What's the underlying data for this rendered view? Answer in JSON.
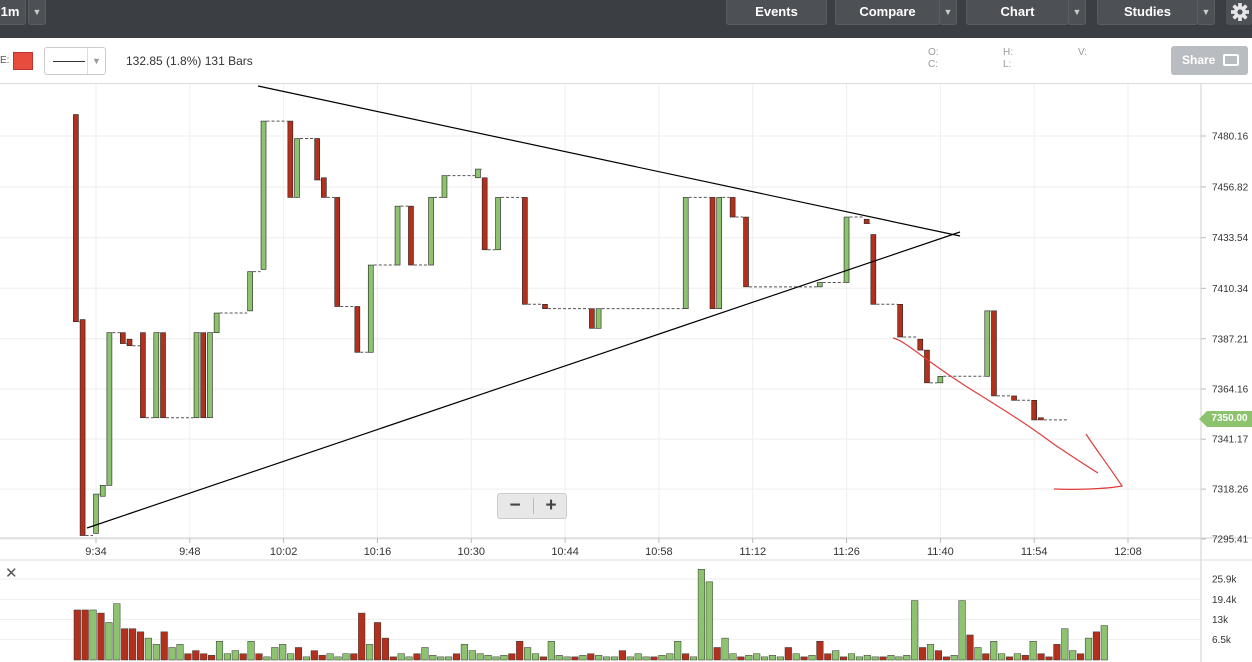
{
  "toolbar": {
    "interval": "1m",
    "events": "Events",
    "compare": "Compare",
    "chart": "Chart",
    "studies": "Studies",
    "caret": "▼",
    "settings_icon": "gear-icon"
  },
  "subbar": {
    "color_label": "E:",
    "series_color": "#e74c3c",
    "summary": "132.85 (1.8%) 131 Bars",
    "o_label": "O:",
    "c_label": "C:",
    "h_label": "H:",
    "l_label": "L:",
    "v_label": "V:",
    "share": "Share"
  },
  "zoom": {
    "out": "−",
    "in": "+"
  },
  "volume_panel": {
    "close": "✕"
  },
  "chart_data": {
    "type": "bar",
    "style": "hlc-bars",
    "up_color": "#8dc26f",
    "down_color": "#b3311c",
    "y_ticks": [
      "7480.16",
      "7456.82",
      "7433.54",
      "7410.34",
      "7387.21",
      "7364.16",
      "7341.17",
      "7318.26",
      "7295.41"
    ],
    "x_ticks": [
      "9:34",
      "9:48",
      "10:02",
      "10:16",
      "10:30",
      "10:44",
      "10:58",
      "11:12",
      "11:26",
      "11:40",
      "11:54",
      "12:08"
    ],
    "last_price": "7350.00",
    "ylim": [
      7295.41,
      7490
    ],
    "grid": true,
    "bars": [
      {
        "t": "9:31",
        "high": 7490,
        "low": 7395,
        "dir": "down"
      },
      {
        "t": "9:32",
        "high": 7396,
        "low": 7297,
        "dir": "down"
      },
      {
        "t": "9:34",
        "high": 7316,
        "low": 7298,
        "dir": "up"
      },
      {
        "t": "9:35",
        "high": 7320,
        "low": 7315,
        "dir": "up"
      },
      {
        "t": "9:36",
        "high": 7390,
        "low": 7320,
        "dir": "up"
      },
      {
        "t": "9:38",
        "high": 7390,
        "low": 7385,
        "dir": "down"
      },
      {
        "t": "9:39",
        "high": 7387,
        "low": 7384,
        "dir": "down"
      },
      {
        "t": "9:41",
        "high": 7390,
        "low": 7351,
        "dir": "down"
      },
      {
        "t": "9:43",
        "high": 7390,
        "low": 7351,
        "dir": "up"
      },
      {
        "t": "9:44",
        "high": 7390,
        "low": 7351,
        "dir": "down"
      },
      {
        "t": "9:49",
        "high": 7390,
        "low": 7351,
        "dir": "up"
      },
      {
        "t": "9:50",
        "high": 7390,
        "low": 7351,
        "dir": "down"
      },
      {
        "t": "9:51",
        "high": 7390,
        "low": 7351,
        "dir": "up"
      },
      {
        "t": "9:52",
        "high": 7399,
        "low": 7390,
        "dir": "up"
      },
      {
        "t": "9:57",
        "high": 7418,
        "low": 7400,
        "dir": "up"
      },
      {
        "t": "9:59",
        "high": 7487,
        "low": 7419,
        "dir": "up"
      },
      {
        "t": "10:03",
        "high": 7487,
        "low": 7452,
        "dir": "down"
      },
      {
        "t": "10:04",
        "high": 7479,
        "low": 7452,
        "dir": "up"
      },
      {
        "t": "10:07",
        "high": 7479,
        "low": 7460,
        "dir": "down"
      },
      {
        "t": "10:08",
        "high": 7461,
        "low": 7452,
        "dir": "down"
      },
      {
        "t": "10:10",
        "high": 7452,
        "low": 7402,
        "dir": "down"
      },
      {
        "t": "10:13",
        "high": 7402,
        "low": 7381,
        "dir": "down"
      },
      {
        "t": "10:15",
        "high": 7421,
        "low": 7381,
        "dir": "up"
      },
      {
        "t": "10:19",
        "high": 7448,
        "low": 7421,
        "dir": "up"
      },
      {
        "t": "10:21",
        "high": 7448,
        "low": 7421,
        "dir": "down"
      },
      {
        "t": "10:24",
        "high": 7452,
        "low": 7421,
        "dir": "up"
      },
      {
        "t": "10:26",
        "high": 7462,
        "low": 7452,
        "dir": "up"
      },
      {
        "t": "10:31",
        "high": 7465,
        "low": 7461,
        "dir": "up"
      },
      {
        "t": "10:32",
        "high": 7461,
        "low": 7428,
        "dir": "down"
      },
      {
        "t": "10:34",
        "high": 7452,
        "low": 7428,
        "dir": "up"
      },
      {
        "t": "10:38",
        "high": 7452,
        "low": 7403,
        "dir": "down"
      },
      {
        "t": "10:41",
        "high": 7403,
        "low": 7401,
        "dir": "down"
      },
      {
        "t": "10:48",
        "high": 7401,
        "low": 7392,
        "dir": "down"
      },
      {
        "t": "10:49",
        "high": 7401,
        "low": 7392,
        "dir": "up"
      },
      {
        "t": "11:02",
        "high": 7452,
        "low": 7401,
        "dir": "up"
      },
      {
        "t": "11:06",
        "high": 7452,
        "low": 7401,
        "dir": "down"
      },
      {
        "t": "11:07",
        "high": 7452,
        "low": 7401,
        "dir": "up"
      },
      {
        "t": "11:09",
        "high": 7452,
        "low": 7443,
        "dir": "down"
      },
      {
        "t": "11:11",
        "high": 7443,
        "low": 7411,
        "dir": "down"
      },
      {
        "t": "11:22",
        "high": 7413,
        "low": 7411,
        "dir": "up"
      },
      {
        "t": "11:26",
        "high": 7443,
        "low": 7413,
        "dir": "up"
      },
      {
        "t": "11:29",
        "high": 7442,
        "low": 7440,
        "dir": "down"
      },
      {
        "t": "11:30",
        "high": 7435,
        "low": 7403,
        "dir": "down"
      },
      {
        "t": "11:34",
        "high": 7403,
        "low": 7388,
        "dir": "down"
      },
      {
        "t": "11:37",
        "high": 7387,
        "low": 7382,
        "dir": "down"
      },
      {
        "t": "11:38",
        "high": 7382,
        "low": 7367,
        "dir": "down"
      },
      {
        "t": "11:40",
        "high": 7370,
        "low": 7367,
        "dir": "up"
      },
      {
        "t": "11:47",
        "high": 7400,
        "low": 7370,
        "dir": "up"
      },
      {
        "t": "11:48",
        "high": 7400,
        "low": 7361,
        "dir": "down"
      },
      {
        "t": "11:51",
        "high": 7361,
        "low": 7359,
        "dir": "down"
      },
      {
        "t": "11:54",
        "high": 7359,
        "low": 7350,
        "dir": "down"
      },
      {
        "t": "11:55",
        "high": 7351,
        "low": 7350,
        "dir": "down"
      }
    ],
    "volume_ticks": [
      "25.9k",
      "19.4k",
      "13k",
      "6.5k"
    ],
    "volume_max": 29000,
    "volume_colors": [
      "r",
      "r",
      "g",
      "r",
      "g",
      "g",
      "r",
      "r",
      "r",
      "g",
      "g",
      "r",
      "g",
      "g",
      "r",
      "r",
      "r",
      "r",
      "g",
      "g",
      "g",
      "r",
      "g",
      "r",
      "g",
      "g",
      "g",
      "g",
      "r",
      "g",
      "r",
      "r",
      "g",
      "g",
      "g",
      "r",
      "r",
      "g",
      "r",
      "r",
      "r",
      "g",
      "g",
      "r",
      "g",
      "g",
      "g",
      "g",
      "r",
      "g",
      "g",
      "g",
      "g",
      "g",
      "g",
      "r",
      "r",
      "g",
      "g",
      "r",
      "g",
      "g",
      "g",
      "r",
      "g",
      "r",
      "g",
      "g",
      "g",
      "r",
      "g",
      "g",
      "g",
      "r",
      "g",
      "g",
      "g",
      "r",
      "g",
      "g",
      "g",
      "r",
      "g",
      "g",
      "r",
      "g",
      "g",
      "g",
      "g",
      "g",
      "r",
      "g",
      "r",
      "g",
      "r",
      "r",
      "g",
      "r",
      "g",
      "g",
      "g",
      "g",
      "r",
      "g",
      "g",
      "g",
      "g",
      "r",
      "g",
      "r",
      "r",
      "g",
      "g",
      "r",
      "g",
      "r",
      "g",
      "g",
      "r",
      "g",
      "r",
      "g",
      "r",
      "r",
      "r",
      "g",
      "g",
      "r",
      "g",
      "r",
      "g"
    ],
    "volumes": [
      16000,
      16000,
      16000,
      15000,
      12000,
      18000,
      10000,
      10000,
      9000,
      7000,
      5000,
      9000,
      4000,
      5000,
      2000,
      3000,
      2000,
      1500,
      6000,
      2000,
      3000,
      2000,
      6000,
      2000,
      1000,
      4000,
      5000,
      2000,
      4000,
      1000,
      3000,
      1500,
      2000,
      1000,
      2000,
      2000,
      15000,
      5000,
      12000,
      7000,
      1000,
      2000,
      1000,
      2000,
      4000,
      1500,
      1000,
      1000,
      2000,
      5000,
      3000,
      2000,
      1500,
      1000,
      1500,
      2000,
      6000,
      4000,
      2000,
      1000,
      6000,
      1500,
      1000,
      1000,
      1500,
      2000,
      1500,
      1000,
      1000,
      3000,
      1000,
      2000,
      1000,
      1000,
      1500,
      2000,
      6000,
      2000,
      1000,
      29000,
      25000,
      4000,
      7000,
      2000,
      1000,
      1500,
      2000,
      1000,
      1500,
      1000,
      4000,
      2000,
      1000,
      1500,
      6000,
      2000,
      3000,
      1000,
      2000,
      1000,
      1500,
      1000,
      1000,
      1500,
      1000,
      1500,
      19000,
      4000,
      5000,
      3000,
      1000,
      1500,
      19000,
      8000,
      4000,
      2000,
      6000,
      2000,
      1000,
      2000,
      1500,
      6000,
      2000,
      1000,
      5000,
      10000,
      3000,
      2000,
      7000,
      9000,
      11000
    ]
  }
}
